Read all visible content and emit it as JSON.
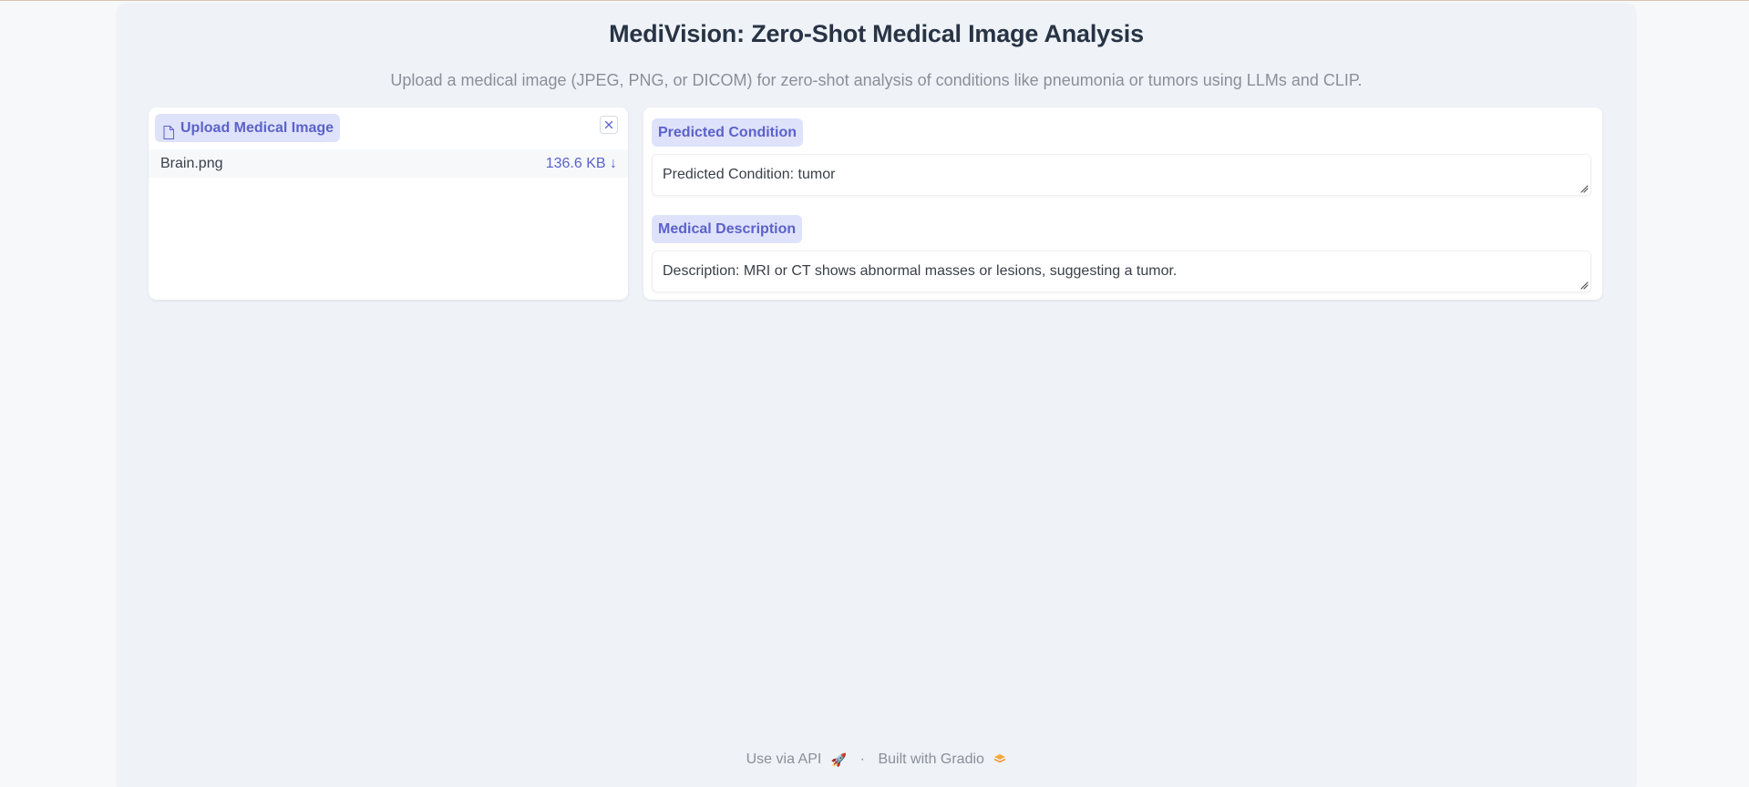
{
  "app": {
    "title": "MediVision: Zero-Shot Medical Image Analysis",
    "subtitle": "Upload a medical image (JPEG, PNG, or DICOM) for zero-shot analysis of conditions like pneumonia or tumors using LLMs and CLIP."
  },
  "upload": {
    "label": "Upload Medical Image",
    "icon": "file-icon",
    "clear_icon": "close-icon",
    "file": {
      "name": "Brain.png",
      "size": "136.6 KB ↓"
    }
  },
  "outputs": {
    "condition": {
      "label": "Predicted Condition",
      "value": "Predicted Condition: tumor"
    },
    "description": {
      "label": "Medical Description",
      "value": "Description: MRI or CT shows abnormal masses or lesions, suggesting a tumor."
    }
  },
  "footer": {
    "api_link": "Use via API",
    "api_icon": "🚀",
    "separator": "·",
    "built_with": "Built with Gradio",
    "gradio_icon": "🟧"
  },
  "colors": {
    "accent": "#5b62c9",
    "chip_bg": "#dfe2fb",
    "app_bg": "#eff3f8"
  }
}
